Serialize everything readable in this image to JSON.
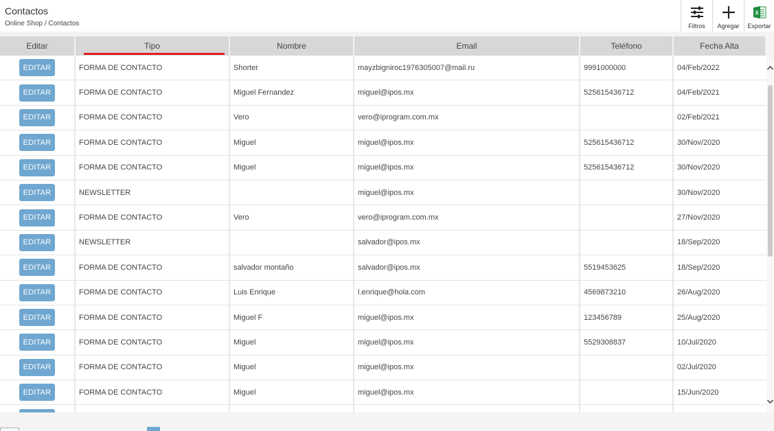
{
  "header": {
    "title": "Contactos",
    "breadcrumb": "Online Shop / Contactos"
  },
  "toolbar": {
    "filters_label": "Filtros",
    "add_label": "Agregar",
    "export_label": "Exportar"
  },
  "table": {
    "columns": [
      "Editar",
      "Tipo",
      "Nombre",
      "Email",
      "Teléfono",
      "Fecha Alta"
    ],
    "edit_label": "EDITAR",
    "sorted_column": "Tipo",
    "rows": [
      {
        "tipo": "FORMA DE CONTACTO",
        "nombre": "Shorter",
        "email": "mayzbigniroc1976305007@mail.ru",
        "telefono": "9991000000",
        "fecha": "04/Feb/2022"
      },
      {
        "tipo": "FORMA DE CONTACTO",
        "nombre": "Miguel Fernandez",
        "email": "miguel@ipos.mx",
        "telefono": "525615436712",
        "fecha": "04/Feb/2021"
      },
      {
        "tipo": "FORMA DE CONTACTO",
        "nombre": "Vero",
        "email": "vero@iprogram.com.mx",
        "telefono": "",
        "fecha": "02/Feb/2021"
      },
      {
        "tipo": "FORMA DE CONTACTO",
        "nombre": "Miguel",
        "email": "miguel@ipos.mx",
        "telefono": "525615436712",
        "fecha": "30/Nov/2020"
      },
      {
        "tipo": "FORMA DE CONTACTO",
        "nombre": "Miguel",
        "email": "miguel@ipos.mx",
        "telefono": "525615436712",
        "fecha": "30/Nov/2020"
      },
      {
        "tipo": "NEWSLETTER",
        "nombre": "",
        "email": "miguel@ipos.mx",
        "telefono": "",
        "fecha": "30/Nov/2020"
      },
      {
        "tipo": "FORMA DE CONTACTO",
        "nombre": "Vero",
        "email": "vero@iprogram.com.mx",
        "telefono": "",
        "fecha": "27/Nov/2020"
      },
      {
        "tipo": "NEWSLETTER",
        "nombre": "",
        "email": "salvador@ipos.mx",
        "telefono": "",
        "fecha": "18/Sep/2020"
      },
      {
        "tipo": "FORMA DE CONTACTO",
        "nombre": "salvador montaño",
        "email": "salvador@ipos.mx",
        "telefono": "5519453625",
        "fecha": "18/Sep/2020"
      },
      {
        "tipo": "FORMA DE CONTACTO",
        "nombre": "Luis Enrique",
        "email": "l.enrique@hola.com",
        "telefono": "4569873210",
        "fecha": "26/Aug/2020"
      },
      {
        "tipo": "FORMA DE CONTACTO",
        "nombre": "Miguel F",
        "email": "miguel@ipos.mx",
        "telefono": "123456789",
        "fecha": "25/Aug/2020"
      },
      {
        "tipo": "FORMA DE CONTACTO",
        "nombre": "Miguel",
        "email": "miguel@ipos.mx",
        "telefono": "5529308837",
        "fecha": "10/Jul/2020"
      },
      {
        "tipo": "FORMA DE CONTACTO",
        "nombre": "Miguel",
        "email": "miguel@ipos.mx",
        "telefono": "",
        "fecha": "02/Jul/2020"
      },
      {
        "tipo": "FORMA DE CONTACTO",
        "nombre": "Miguel",
        "email": "miguel@ipos.mx",
        "telefono": "",
        "fecha": "15/Jun/2020"
      },
      {
        "tipo": "",
        "nombre": "",
        "email": "",
        "telefono": "",
        "fecha": ""
      }
    ]
  },
  "colors": {
    "edit_button": "#6fa7d0",
    "sort_indicator": "#e02020",
    "header_bg": "#d7d7d7",
    "excel_green": "#1e8e3e"
  },
  "icons": {
    "filters": "sliders-icon",
    "add": "plus-icon",
    "export": "excel-icon"
  }
}
